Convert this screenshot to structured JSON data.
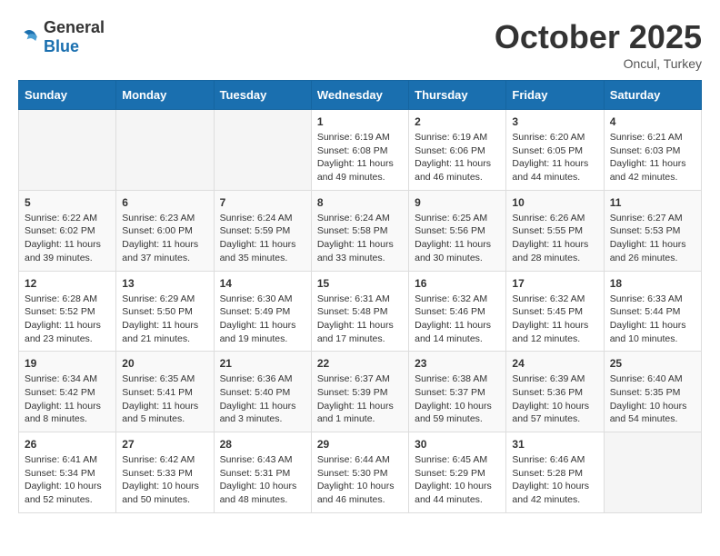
{
  "header": {
    "logo_general": "General",
    "logo_blue": "Blue",
    "month": "October 2025",
    "location": "Oncul, Turkey"
  },
  "days_of_week": [
    "Sunday",
    "Monday",
    "Tuesday",
    "Wednesday",
    "Thursday",
    "Friday",
    "Saturday"
  ],
  "weeks": [
    [
      {
        "day": "",
        "info": ""
      },
      {
        "day": "",
        "info": ""
      },
      {
        "day": "",
        "info": ""
      },
      {
        "day": "1",
        "info": "Sunrise: 6:19 AM\nSunset: 6:08 PM\nDaylight: 11 hours\nand 49 minutes."
      },
      {
        "day": "2",
        "info": "Sunrise: 6:19 AM\nSunset: 6:06 PM\nDaylight: 11 hours\nand 46 minutes."
      },
      {
        "day": "3",
        "info": "Sunrise: 6:20 AM\nSunset: 6:05 PM\nDaylight: 11 hours\nand 44 minutes."
      },
      {
        "day": "4",
        "info": "Sunrise: 6:21 AM\nSunset: 6:03 PM\nDaylight: 11 hours\nand 42 minutes."
      }
    ],
    [
      {
        "day": "5",
        "info": "Sunrise: 6:22 AM\nSunset: 6:02 PM\nDaylight: 11 hours\nand 39 minutes."
      },
      {
        "day": "6",
        "info": "Sunrise: 6:23 AM\nSunset: 6:00 PM\nDaylight: 11 hours\nand 37 minutes."
      },
      {
        "day": "7",
        "info": "Sunrise: 6:24 AM\nSunset: 5:59 PM\nDaylight: 11 hours\nand 35 minutes."
      },
      {
        "day": "8",
        "info": "Sunrise: 6:24 AM\nSunset: 5:58 PM\nDaylight: 11 hours\nand 33 minutes."
      },
      {
        "day": "9",
        "info": "Sunrise: 6:25 AM\nSunset: 5:56 PM\nDaylight: 11 hours\nand 30 minutes."
      },
      {
        "day": "10",
        "info": "Sunrise: 6:26 AM\nSunset: 5:55 PM\nDaylight: 11 hours\nand 28 minutes."
      },
      {
        "day": "11",
        "info": "Sunrise: 6:27 AM\nSunset: 5:53 PM\nDaylight: 11 hours\nand 26 minutes."
      }
    ],
    [
      {
        "day": "12",
        "info": "Sunrise: 6:28 AM\nSunset: 5:52 PM\nDaylight: 11 hours\nand 23 minutes."
      },
      {
        "day": "13",
        "info": "Sunrise: 6:29 AM\nSunset: 5:50 PM\nDaylight: 11 hours\nand 21 minutes."
      },
      {
        "day": "14",
        "info": "Sunrise: 6:30 AM\nSunset: 5:49 PM\nDaylight: 11 hours\nand 19 minutes."
      },
      {
        "day": "15",
        "info": "Sunrise: 6:31 AM\nSunset: 5:48 PM\nDaylight: 11 hours\nand 17 minutes."
      },
      {
        "day": "16",
        "info": "Sunrise: 6:32 AM\nSunset: 5:46 PM\nDaylight: 11 hours\nand 14 minutes."
      },
      {
        "day": "17",
        "info": "Sunrise: 6:32 AM\nSunset: 5:45 PM\nDaylight: 11 hours\nand 12 minutes."
      },
      {
        "day": "18",
        "info": "Sunrise: 6:33 AM\nSunset: 5:44 PM\nDaylight: 11 hours\nand 10 minutes."
      }
    ],
    [
      {
        "day": "19",
        "info": "Sunrise: 6:34 AM\nSunset: 5:42 PM\nDaylight: 11 hours\nand 8 minutes."
      },
      {
        "day": "20",
        "info": "Sunrise: 6:35 AM\nSunset: 5:41 PM\nDaylight: 11 hours\nand 5 minutes."
      },
      {
        "day": "21",
        "info": "Sunrise: 6:36 AM\nSunset: 5:40 PM\nDaylight: 11 hours\nand 3 minutes."
      },
      {
        "day": "22",
        "info": "Sunrise: 6:37 AM\nSunset: 5:39 PM\nDaylight: 11 hours\nand 1 minute."
      },
      {
        "day": "23",
        "info": "Sunrise: 6:38 AM\nSunset: 5:37 PM\nDaylight: 10 hours\nand 59 minutes."
      },
      {
        "day": "24",
        "info": "Sunrise: 6:39 AM\nSunset: 5:36 PM\nDaylight: 10 hours\nand 57 minutes."
      },
      {
        "day": "25",
        "info": "Sunrise: 6:40 AM\nSunset: 5:35 PM\nDaylight: 10 hours\nand 54 minutes."
      }
    ],
    [
      {
        "day": "26",
        "info": "Sunrise: 6:41 AM\nSunset: 5:34 PM\nDaylight: 10 hours\nand 52 minutes."
      },
      {
        "day": "27",
        "info": "Sunrise: 6:42 AM\nSunset: 5:33 PM\nDaylight: 10 hours\nand 50 minutes."
      },
      {
        "day": "28",
        "info": "Sunrise: 6:43 AM\nSunset: 5:31 PM\nDaylight: 10 hours\nand 48 minutes."
      },
      {
        "day": "29",
        "info": "Sunrise: 6:44 AM\nSunset: 5:30 PM\nDaylight: 10 hours\nand 46 minutes."
      },
      {
        "day": "30",
        "info": "Sunrise: 6:45 AM\nSunset: 5:29 PM\nDaylight: 10 hours\nand 44 minutes."
      },
      {
        "day": "31",
        "info": "Sunrise: 6:46 AM\nSunset: 5:28 PM\nDaylight: 10 hours\nand 42 minutes."
      },
      {
        "day": "",
        "info": ""
      }
    ]
  ]
}
